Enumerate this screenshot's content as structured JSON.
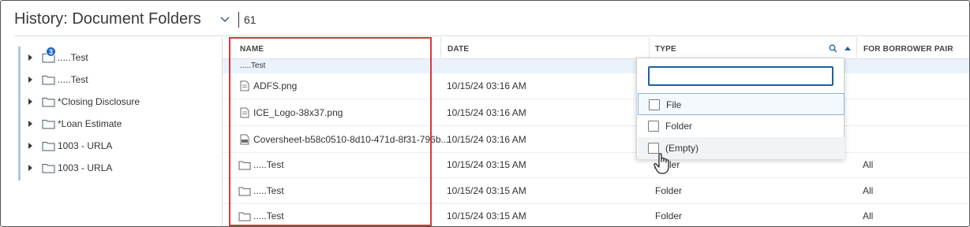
{
  "header": {
    "title": "History: Document Folders",
    "count": "61",
    "chevron_icon": "chevron-down-icon"
  },
  "tree": {
    "items": [
      {
        "label": ".....Test",
        "badge": "3"
      },
      {
        "label": ".....Test"
      },
      {
        "label": "*Closing Disclosure"
      },
      {
        "label": "*Loan Estimate"
      },
      {
        "label": "1003 - URLA"
      },
      {
        "label": "1003 - URLA"
      }
    ]
  },
  "grid": {
    "columns": {
      "name": "NAME",
      "date": "DATE",
      "type": "TYPE",
      "borrower": "FOR BORROWER PAIR"
    },
    "group_label": ".....Test",
    "rows": [
      {
        "name": "ADFS.png",
        "date": "10/15/24 03:16 AM",
        "type": "",
        "borrower": "",
        "icon": "file-icon"
      },
      {
        "name": "ICE_Logo-38x37.png",
        "date": "10/15/24 03:16 AM",
        "type": "",
        "borrower": "",
        "icon": "file-icon"
      },
      {
        "name": "Coversheet-b58c0510-8d10-471d-8f31-796b...",
        "date": "10/15/24 03:16 AM",
        "type": "",
        "borrower": "",
        "icon": "pdf-file-icon"
      },
      {
        "name": ".....Test",
        "date": "10/15/24 03:15 AM",
        "type": "ler",
        "borrower": "All",
        "icon": "folder-icon"
      },
      {
        "name": ".....Test",
        "date": "10/15/24 03:15 AM",
        "type": "Folder",
        "borrower": "All",
        "icon": "folder-icon"
      },
      {
        "name": ".....Test",
        "date": "10/15/24 03:15 AM",
        "type": "Folder",
        "borrower": "All",
        "icon": "folder-icon"
      }
    ]
  },
  "type_filter": {
    "search_value": "",
    "options": [
      {
        "label": "File",
        "checked": false
      },
      {
        "label": "Folder",
        "checked": false
      },
      {
        "label": "(Empty)",
        "checked": false
      }
    ]
  },
  "colors": {
    "accent": "#1f5ea8",
    "badge": "#1e66c7",
    "highlight_border": "#d9373a",
    "group_row_bg": "#eaf3fb",
    "tree_bar": "#a9c7e6"
  }
}
